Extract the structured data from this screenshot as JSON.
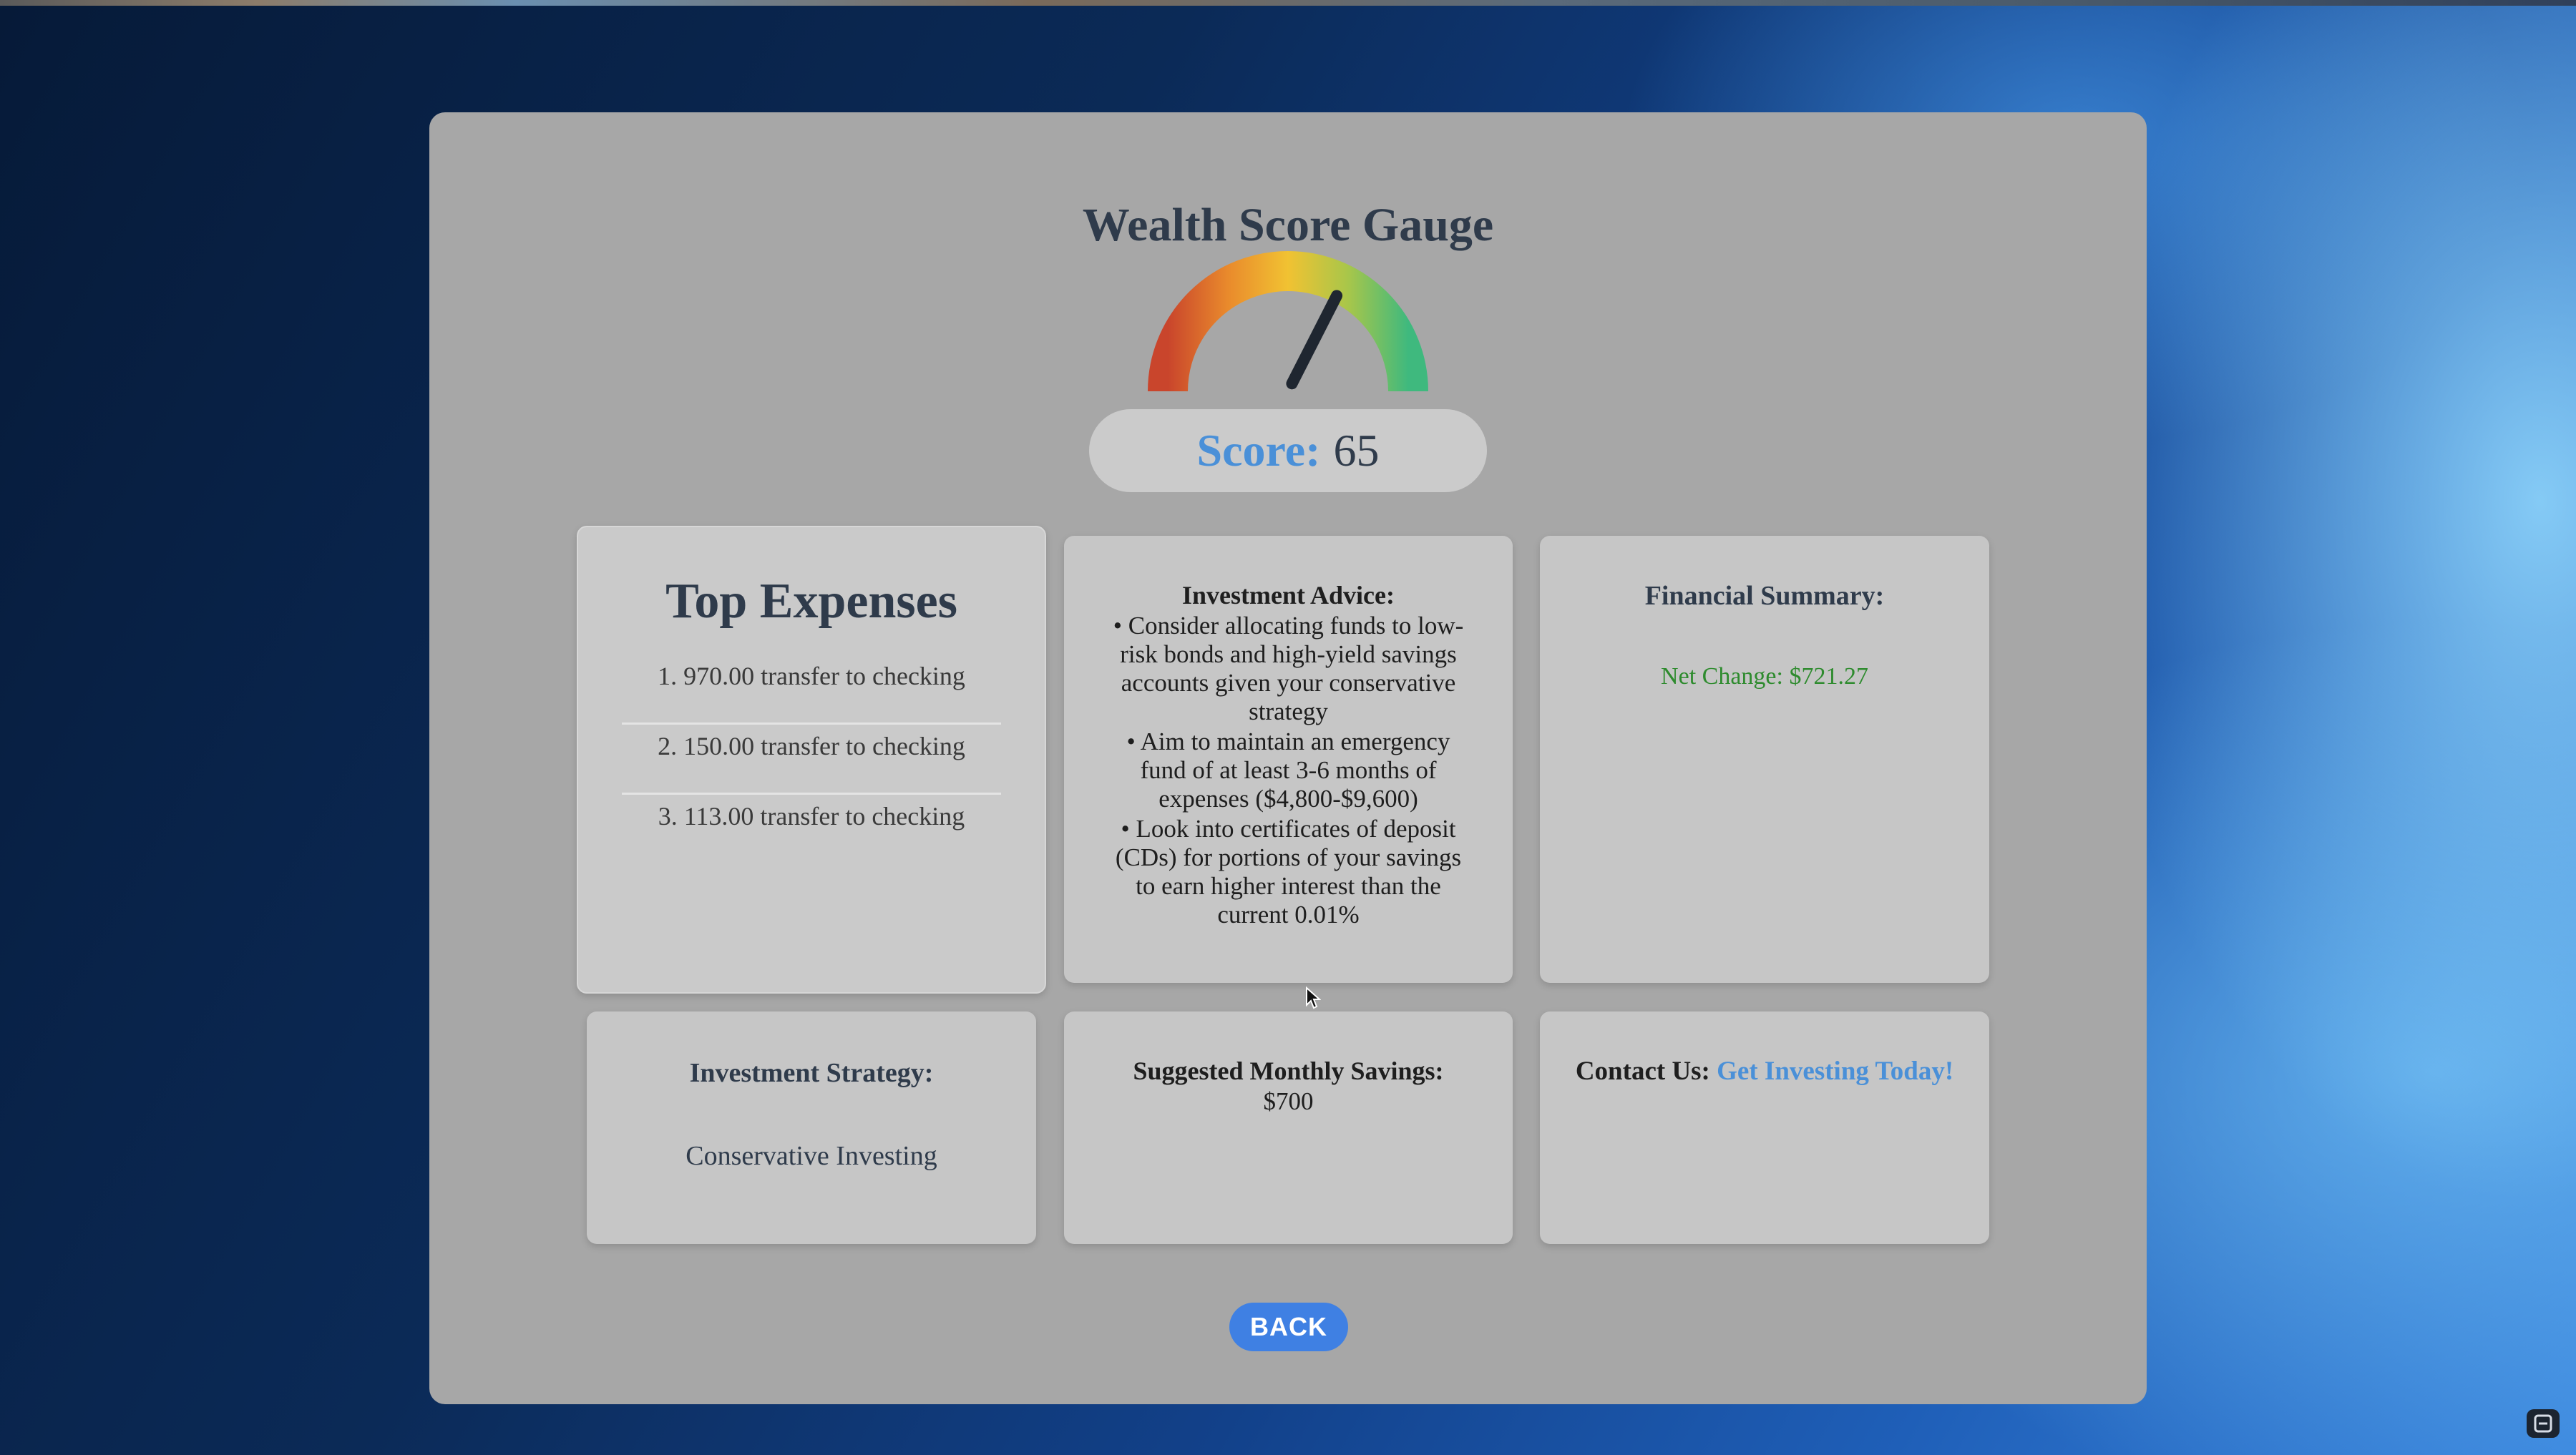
{
  "gauge": {
    "title": "Wealth Score Gauge",
    "score_label": "Score:",
    "score_value": "65",
    "score_fraction": 0.65,
    "colors": [
      "#c9452c",
      "#e98a2c",
      "#f1c232",
      "#a8c64a",
      "#3fb97e"
    ]
  },
  "top_expenses": {
    "title": "Top Expenses",
    "items": [
      "1. 970.00 transfer to checking",
      "2. 150.00 transfer to checking",
      "3. 113.00 transfer to checking"
    ]
  },
  "investment_advice": {
    "title": "Investment Advice:",
    "bullets": [
      "• Consider allocating funds to low-risk bonds and high-yield savings accounts given your conservative strategy",
      "• Aim to maintain an emergency fund of at least 3-6 months of expenses ($4,800-$9,600)",
      "• Look into certificates of deposit (CDs) for portions of your savings to earn higher interest than the current 0.01%"
    ]
  },
  "financial_summary": {
    "title": "Financial Summary:",
    "net_change": "Net Change: $721.27"
  },
  "investment_strategy": {
    "title": "Investment Strategy:",
    "value": "Conservative Investing"
  },
  "monthly_savings": {
    "title": "Suggested Monthly Savings:",
    "value": "$700"
  },
  "contact": {
    "label": "Contact Us:",
    "link_text": "Get Investing Today!"
  },
  "back_button": {
    "label": "BACK"
  },
  "icons": {
    "cursor": "cursor-arrow-icon",
    "corner": "screenshot-icon"
  }
}
